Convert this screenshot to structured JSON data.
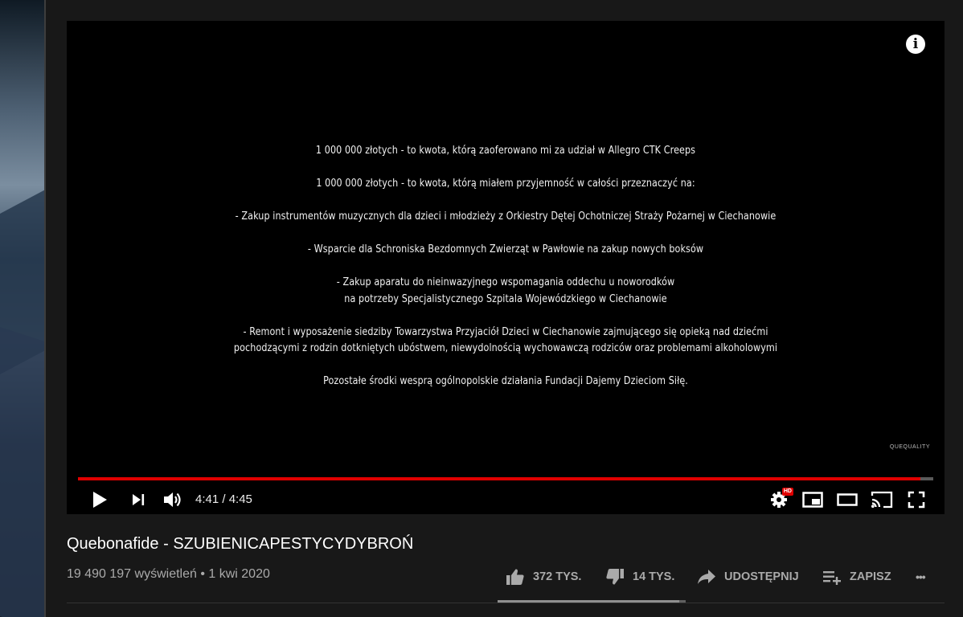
{
  "player": {
    "info_glyph": "i",
    "video_lines": [
      "1 000 000 złotych - to kwota, którą zaoferowano mi za udział w Allegro CTK Creeps",
      "",
      "1 000 000 złotych - to kwota, którą miałem przyjemność w całości przeznaczyć na:",
      "",
      "- Zakup instrumentów muzycznych dla dzieci i młodzieży z Orkiestry Dętej Ochotniczej Straży Pożarnej w Ciechanowie",
      "",
      "- Wsparcie dla Schroniska Bezdomnych Zwierząt w Pawłowie na zakup nowych boksów",
      "",
      "- Zakup aparatu do nieinwazyjnego wspomagania oddechu u noworodków",
      "na potrzeby Specjalistycznego Szpitala Wojewódzkiego w Ciechanowie",
      "",
      "- Remont i wyposażenie siedziby Towarzystwa Przyjaciół Dzieci w Ciechanowie zajmującego się opieką nad dziećmi",
      "pochodzącymi z rodzin dotkniętych ubóstwem, niewydolnością wychowawczą rodziców oraz problemami alkoholowymi",
      "",
      "Pozostałe środki wesprą ogólnopolskie działania Fundacji Dajemy Dzieciom Siłę."
    ],
    "watermark": "QUEQUALITY",
    "time_display": "4:41 / 4:45",
    "progress_fraction": 0.9851,
    "hd_badge": "HD",
    "colors": {
      "progress": "#e00000",
      "buffer": "#5a5a5a",
      "background": "#000000"
    },
    "icons": {
      "play": "play-icon",
      "next": "next-icon",
      "volume": "volume-icon",
      "settings": "settings-icon",
      "miniplayer": "miniplayer-icon",
      "theater": "theater-mode-icon",
      "cast": "cast-icon",
      "fullscreen": "fullscreen-icon"
    }
  },
  "video": {
    "title": "Quebonafide - SZUBIENICAPESTYCYDYBROŃ",
    "views": "19 490 197 wyświetleń",
    "separator": "•",
    "date": "1 kwi 2020",
    "meta_line": "19 490 197 wyświetleń • 1 kwi 2020"
  },
  "actions": {
    "like_label": "372 TYS.",
    "dislike_label": "14 TYS.",
    "share_label": "UDOSTĘPNIJ",
    "save_label": "ZAPISZ",
    "more_label": "•••",
    "like_ratio": 0.9637,
    "icons": {
      "like": "thumbs-up-icon",
      "dislike": "thumbs-down-icon",
      "share": "share-icon",
      "save": "playlist-add-icon",
      "more": "more-icon"
    }
  }
}
